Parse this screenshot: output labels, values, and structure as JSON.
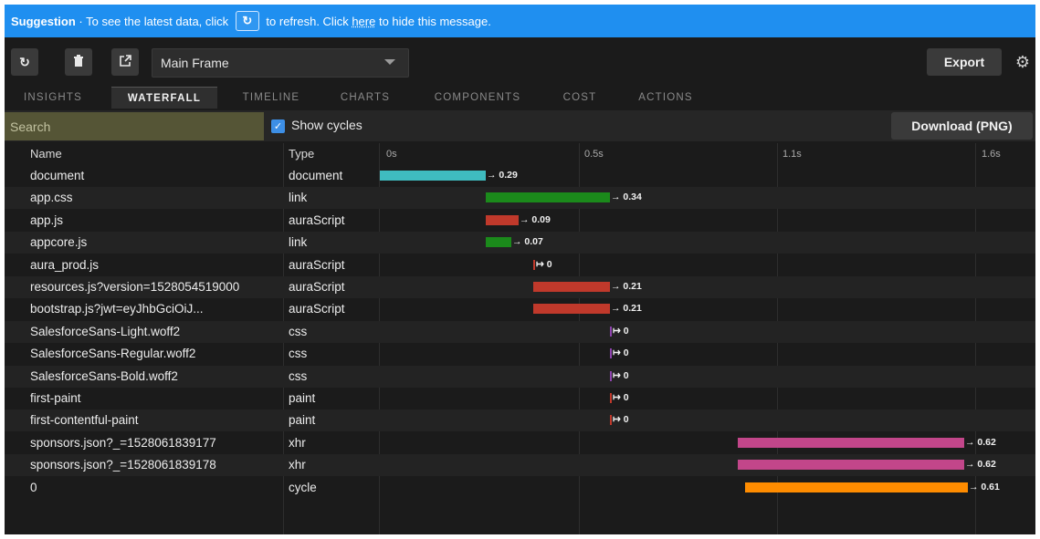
{
  "banner": {
    "prefix": "Suggestion",
    "text1": " · To see the latest data, click ",
    "text2": " to refresh. Click ",
    "link": "here",
    "text3": " to hide this message."
  },
  "toolbar": {
    "refresh_icon": "refresh-icon",
    "delete_icon": "trash-icon",
    "popout_icon": "external-link-icon",
    "frame_select_value": "Main Frame",
    "export_label": "Export",
    "settings_icon": "gear-icon"
  },
  "tabs": [
    "INSIGHTS",
    "WATERFALL",
    "TIMELINE",
    "CHARTS",
    "COMPONENTS",
    "COST",
    "ACTIONS"
  ],
  "active_tab": "WATERFALL",
  "filter": {
    "search_placeholder": "Search",
    "show_cycles_label": "Show cycles",
    "show_cycles_checked": true,
    "download_label": "Download (PNG)"
  },
  "table": {
    "columns": {
      "name": "Name",
      "type": "Type"
    },
    "timeline_ticks": [
      "0s",
      "0.5s",
      "1.1s",
      "1.6s"
    ],
    "timeline_tick_values": [
      0,
      0.5,
      1.1,
      1.6
    ],
    "rows": [
      {
        "name": "document",
        "type": "document",
        "start": 0.0,
        "duration": 0.29,
        "label": "→ 0.29",
        "color": "#3fbcc0"
      },
      {
        "name": "app.css",
        "type": "link",
        "start": 0.29,
        "duration": 0.34,
        "label": "→ 0.34",
        "color": "#1b8a1b"
      },
      {
        "name": "app.js",
        "type": "auraScript",
        "start": 0.29,
        "duration": 0.09,
        "label": "→ 0.09",
        "color": "#c0392b"
      },
      {
        "name": "appcore.js",
        "type": "link",
        "start": 0.29,
        "duration": 0.07,
        "label": "→ 0.07",
        "color": "#1b8a1b"
      },
      {
        "name": "aura_prod.js",
        "type": "auraScript",
        "start": 0.42,
        "duration": 0.0,
        "label": "↦ 0",
        "color": "#c0392b"
      },
      {
        "name": "resources.js?version=1528054519000",
        "type": "auraScript",
        "start": 0.42,
        "duration": 0.21,
        "label": "→ 0.21",
        "color": "#c0392b"
      },
      {
        "name": "bootstrap.js?jwt=eyJhbGciOiJ...",
        "type": "auraScript",
        "start": 0.42,
        "duration": 0.21,
        "label": "→ 0.21",
        "color": "#c0392b"
      },
      {
        "name": "SalesforceSans-Light.woff2",
        "type": "css",
        "start": 0.63,
        "duration": 0.0,
        "label": "↦ 0",
        "color": "#8e44ad"
      },
      {
        "name": "SalesforceSans-Regular.woff2",
        "type": "css",
        "start": 0.63,
        "duration": 0.0,
        "label": "↦ 0",
        "color": "#8e44ad"
      },
      {
        "name": "SalesforceSans-Bold.woff2",
        "type": "css",
        "start": 0.63,
        "duration": 0.0,
        "label": "↦ 0",
        "color": "#8e44ad"
      },
      {
        "name": "first-paint",
        "type": "paint",
        "start": 0.63,
        "duration": 0.0,
        "label": "↦ 0",
        "color": "#c0392b"
      },
      {
        "name": "first-contentful-paint",
        "type": "paint",
        "start": 0.63,
        "duration": 0.0,
        "label": "↦ 0",
        "color": "#c0392b"
      },
      {
        "name": "sponsors.json?_=1528061839177",
        "type": "xhr",
        "start": 0.98,
        "duration": 0.62,
        "label": "→ 0.62",
        "color": "#c2468a"
      },
      {
        "name": "sponsors.json?_=1528061839178",
        "type": "xhr",
        "start": 0.98,
        "duration": 0.62,
        "label": "→ 0.62",
        "color": "#c2468a"
      },
      {
        "name": "0",
        "type": "cycle",
        "start": 1.0,
        "duration": 0.61,
        "label": "→ 0.61",
        "color": "#ff8c00"
      }
    ]
  }
}
